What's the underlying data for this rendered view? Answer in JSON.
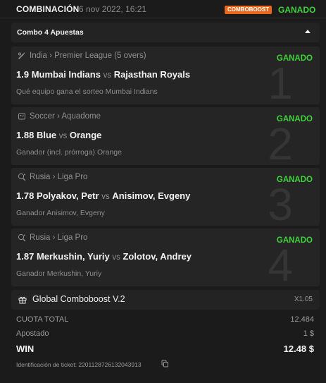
{
  "header": {
    "type_label": "COMBINACIÓN",
    "date": "6 nov 2022, 16:21",
    "badge": "COMBOBOOST",
    "status": "GANADO",
    "status_color": "#3fd23a",
    "badge_color": "#e8671c"
  },
  "combo": {
    "title": "Combo 4 Apuestas",
    "toggle_icon": "caret-up-icon"
  },
  "bets": [
    {
      "number": "1",
      "sport_icon": "cricket-icon",
      "league": "India › Premier League (5 overs)",
      "status": "GANADO",
      "odds": "1.9",
      "team_home": "Mumbai Indians",
      "vs": "vs",
      "team_away": "Rajasthan Royals",
      "selection": "Qué equipo gana el sorteo Mumbai Indians"
    },
    {
      "number": "2",
      "sport_icon": "soccer-icon",
      "league": "Soccer › Aquadome",
      "status": "GANADO",
      "odds": "1.88",
      "team_home": "Blue",
      "vs": "vs",
      "team_away": "Orange",
      "selection": "Ganador (incl. prórroga) Orange"
    },
    {
      "number": "3",
      "sport_icon": "table-tennis-icon",
      "league": "Rusia › Liga Pro",
      "status": "GANADO",
      "odds": "1.78",
      "team_home": "Polyakov, Petr",
      "vs": "vs",
      "team_away": "Anisimov, Evgeny",
      "selection": "Ganador Anisimov, Evgeny"
    },
    {
      "number": "4",
      "sport_icon": "table-tennis-icon",
      "league": "Rusia › Liga Pro",
      "status": "GANADO",
      "odds": "1.87",
      "team_home": "Merkushin, Yuriy",
      "vs": "vs",
      "team_away": "Zolotov, Andrey",
      "selection": "Ganador Merkushin, Yuriy"
    }
  ],
  "global": {
    "icon": "gift-icon",
    "label": "Global Comboboost V.2",
    "multiplier": "X1.05"
  },
  "summary": {
    "total_odds_label": "CUOTA TOTAL",
    "total_odds_value": "12.484",
    "stake_label": "Apostado",
    "stake_value": "1 $",
    "win_label": "WIN",
    "win_value": "12.48 $"
  },
  "ticket": {
    "label": "Identificación de ticket: 2201128726132043913",
    "copy_icon": "copy-icon"
  }
}
